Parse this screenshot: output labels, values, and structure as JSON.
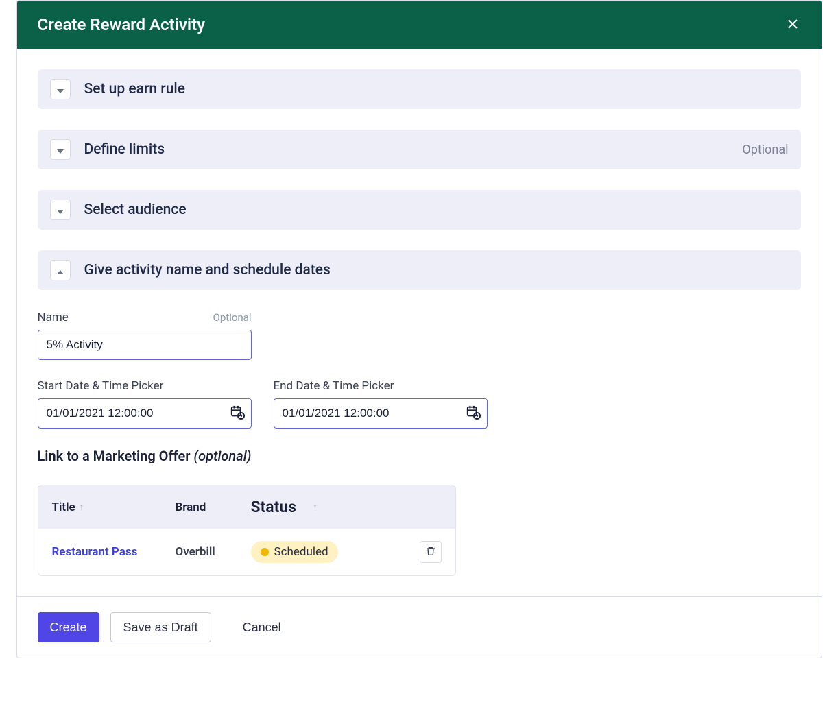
{
  "header": {
    "title": "Create Reward Activity"
  },
  "sections": {
    "earn_rule": {
      "title": "Set up earn rule"
    },
    "limits": {
      "title": "Define limits",
      "tag": "Optional"
    },
    "audience": {
      "title": "Select audience"
    },
    "schedule": {
      "title": "Give activity name and schedule dates"
    }
  },
  "fields": {
    "name": {
      "label": "Name",
      "optional_hint": "Optional",
      "value": "5% Activity"
    },
    "start": {
      "label": "Start Date & Time Picker",
      "value": "01/01/2021 12:00:00"
    },
    "end": {
      "label": "End Date & Time Picker",
      "value": "01/01/2021 12:00:00"
    }
  },
  "link_offer": {
    "heading_main": "Link to a Marketing Offer ",
    "heading_optional": "(optional)",
    "columns": {
      "title": "Title",
      "brand": "Brand",
      "status": "Status"
    },
    "row": {
      "title": "Restaurant Pass",
      "brand": "Overbill",
      "status": "Scheduled"
    }
  },
  "footer": {
    "create": "Create",
    "draft": "Save as Draft",
    "cancel": "Cancel"
  }
}
